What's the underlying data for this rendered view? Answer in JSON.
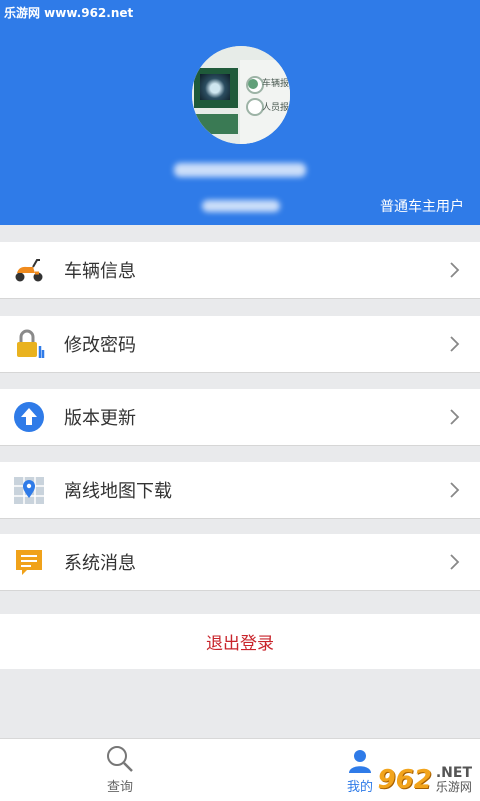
{
  "watermark": {
    "top_left": "乐游网 www.962.net",
    "bottom_right_brand": "962",
    "bottom_right_tld": ".NET",
    "bottom_right_name": "乐游网"
  },
  "profile": {
    "user_type": "普通车主用户",
    "avatar_texts": [
      "车辆报警",
      "人员报警"
    ]
  },
  "menu": [
    {
      "label": "车辆信息",
      "icon": "scooter-icon"
    },
    {
      "label": "修改密码",
      "icon": "lock-icon"
    },
    {
      "label": "版本更新",
      "icon": "upload-arrow-icon"
    },
    {
      "label": "离线地图下载",
      "icon": "map-pin-icon"
    },
    {
      "label": "系统消息",
      "icon": "message-icon"
    }
  ],
  "logout_label": "退出登录",
  "tabs": [
    {
      "label": "查询",
      "icon": "search-icon"
    },
    {
      "label": "我的",
      "icon": "user-icon"
    }
  ],
  "colors": {
    "header": "#2f7be8",
    "logout": "#c8242b"
  }
}
